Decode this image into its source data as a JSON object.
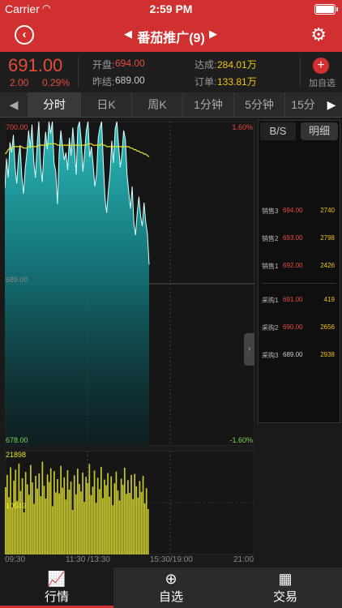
{
  "status_bar": {
    "carrier": "Carrier",
    "time": "2:59 PM"
  },
  "nav": {
    "back_icon": "back-circle-icon",
    "title": "番茄推广(9)",
    "settings_icon": "gear-icon"
  },
  "quote": {
    "price": "691.00",
    "change": "2.00",
    "change_pct": "0.29%",
    "open_label": "开盘:",
    "open_value": "694.00",
    "prev_close_label": "昨结:",
    "prev_close_value": "689.00",
    "deal_label": "达成:",
    "deal_value": "284.01万",
    "order_label": "订单:",
    "order_value": "133.81万",
    "add_watch_label": "加自选"
  },
  "tabs": [
    {
      "label": "分时",
      "active": true
    },
    {
      "label": "日K",
      "active": false
    },
    {
      "label": "周K",
      "active": false
    },
    {
      "label": "1分钟",
      "active": false
    },
    {
      "label": "5分钟",
      "active": false
    },
    {
      "label": "15分",
      "active": false
    }
  ],
  "order_book": {
    "tabs": [
      {
        "label": "B/S",
        "active": true
      },
      {
        "label": "明细",
        "active": false
      }
    ],
    "asks": [
      {
        "name": "销售3",
        "price": "694.00",
        "volume": "2740"
      },
      {
        "name": "销售2",
        "price": "693.00",
        "volume": "2798"
      },
      {
        "name": "销售1",
        "price": "692.00",
        "volume": "2426"
      }
    ],
    "bids": [
      {
        "name": "采购1",
        "price": "691.00",
        "volume": "419"
      },
      {
        "name": "采购2",
        "price": "690.00",
        "volume": "2656"
      },
      {
        "name": "采购3",
        "price": "689.00",
        "volume": "2938"
      }
    ]
  },
  "colors": {
    "up": "#e74c3c",
    "down": "#7ed957",
    "accent": "#d0302f",
    "avg_line": "#e6e62e",
    "volume": "#c9c930"
  },
  "chart_data": [
    {
      "type": "area",
      "y_max_label": "700.00",
      "y_mid_label": "689.00",
      "y_min_label": "678.00",
      "pct_max_label": "1.60%",
      "pct_min_label": "-1.60%",
      "ylim": [
        678,
        700
      ],
      "x_ticks": [
        "09:30",
        "11:30 /13:30",
        "15:30/19:00",
        "21:00"
      ],
      "series": [
        {
          "values": [
            695.5,
            697.5,
            696.2,
            698.6,
            697.9,
            699.1,
            696.9,
            695.8,
            697.6,
            698.4,
            696.3,
            695.1,
            696.8,
            697.9,
            699.4,
            698.2,
            699.8,
            697.4,
            696.2,
            698.4,
            700,
            697.1,
            695.9,
            697.9,
            699.3,
            698.1,
            700,
            699.2,
            700,
            697.2,
            696.6,
            694.4,
            697.9,
            699.4,
            698.3,
            697.4,
            697.9,
            696.7,
            698.9,
            697.7,
            699.6,
            698.2,
            696.4,
            699.6,
            700,
            698.7,
            696.6,
            697.9,
            699.4,
            700,
            697.6,
            698.3,
            697.1,
            695.6,
            696.4,
            698.9,
            699.6,
            700,
            697.2,
            694.8,
            693.8,
            695.3,
            696.5,
            698.7,
            697.2,
            699.5,
            700,
            698.4,
            696.9,
            697.8,
            699.4,
            698.8,
            696.4,
            695.2,
            694.1,
            695.6,
            693.1,
            692.3,
            693.8,
            694.9,
            693.6,
            692.9,
            694.5,
            693.2,
            692.4,
            690.3
          ]
        },
        {
          "values": [
            697.8,
            697.9,
            698.1,
            698.2,
            698.2,
            698.3,
            698.3,
            698.3,
            698.3,
            698.3,
            698.3,
            698.2,
            698.2,
            698.2,
            698.3,
            698.3,
            698.3,
            698.3,
            698.3,
            698.3,
            698.4,
            698.4,
            698.4,
            698.4,
            698.4,
            698.4,
            698.5,
            698.5,
            698.5,
            698.5,
            698.5,
            698.4,
            698.4,
            698.4,
            698.4,
            698.4,
            698.4,
            698.4,
            698.4,
            698.4,
            698.4,
            698.4,
            698.4,
            698.4,
            698.4,
            698.4,
            698.4,
            698.4,
            698.4,
            698.5,
            698.5,
            698.5,
            698.4,
            698.4,
            698.4,
            698.4,
            698.4,
            698.5,
            698.4,
            698.4,
            698.3,
            698.3,
            698.3,
            698.3,
            698.3,
            698.3,
            698.3,
            698.3,
            698.3,
            698.3,
            698.3,
            698.3,
            698.3,
            698.3,
            698.2,
            698.2,
            698.1,
            698.1,
            698,
            698,
            697.9,
            697.9,
            697.8,
            697.8,
            697.7,
            697.6
          ]
        }
      ]
    },
    {
      "type": "bar",
      "y_max_label": "21898",
      "y_mid_label": "10949",
      "ylim": [
        0,
        21898
      ],
      "values": [
        14200,
        16800,
        12100,
        18400,
        9800,
        15600,
        17900,
        11300,
        19200,
        13400,
        16100,
        8900,
        17400,
        14800,
        12600,
        18900,
        15200,
        10700,
        16600,
        13900,
        17100,
        12300,
        19600,
        14500,
        11800,
        16900,
        15300,
        18200,
        10200,
        17600,
        13100,
        15900,
        12900,
        18700,
        14100,
        16300,
        11600,
        17800,
        13700,
        15400,
        9400,
        16700,
        12700,
        18100,
        14900,
        13300,
        17300,
        11100,
        16400,
        15100,
        19100,
        12500,
        14300,
        17700,
        10900,
        16200,
        13800,
        18500,
        11900,
        15800,
        14600,
        17200,
        12200,
        16500,
        10400,
        15000,
        17500,
        13500,
        11400,
        16000,
        14700,
        18300,
        12800,
        15700,
        13000,
        16800,
        11700,
        17000,
        14400,
        12000,
        15500,
        13200,
        16600,
        10800,
        14000,
        9600
      ]
    }
  ],
  "tab_bar": [
    {
      "label": "行情",
      "icon": "chart-line-icon",
      "active": true
    },
    {
      "label": "自选",
      "icon": "plus-circle-icon",
      "active": false
    },
    {
      "label": "交易",
      "icon": "calendar-icon",
      "active": false
    }
  ]
}
